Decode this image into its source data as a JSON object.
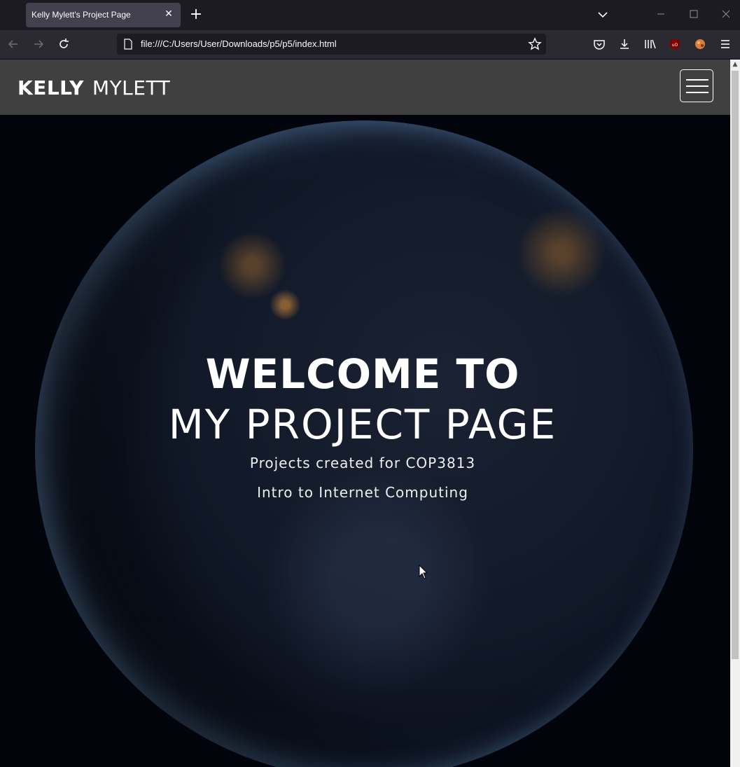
{
  "browser": {
    "tab_title": "Kelly Mylett's Project Page",
    "tab_close": "✕",
    "new_tab": "+",
    "url": "file:///C:/Users/User/Downloads/p5/p5/index.html"
  },
  "header": {
    "brand_first": "KELLY",
    "brand_last": "MYLETT"
  },
  "hero": {
    "line1": "WELCOME TO",
    "line2": "MY PROJECT PAGE",
    "sub1": "Projects created for COP3813",
    "sub2": "Intro to Internet Computing"
  },
  "icons": {
    "back": "back-arrow-icon",
    "forward": "forward-arrow-icon",
    "reload": "reload-icon",
    "page": "page-icon",
    "bookmark": "star-icon",
    "pocket": "pocket-icon",
    "downloads": "download-icon",
    "library": "library-icon",
    "ublock": "ublock-icon",
    "extension": "extension-icon",
    "menu": "hamburger-menu-icon"
  },
  "colors": {
    "chrome_dark": "#1c1b22",
    "chrome_toolbar": "#2b2a33",
    "site_header": "#404040"
  }
}
